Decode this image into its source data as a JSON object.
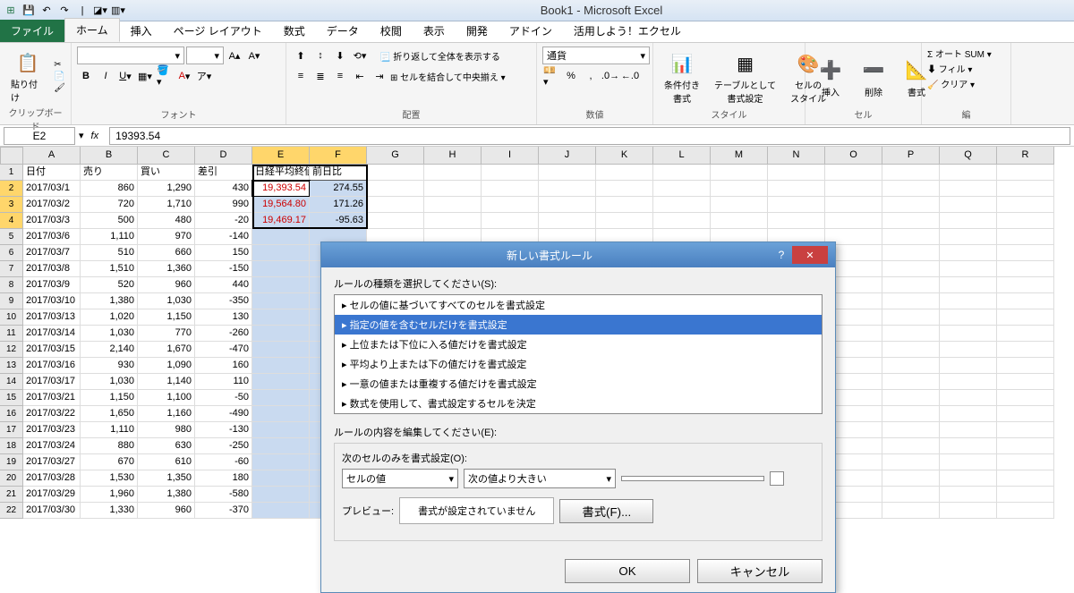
{
  "app": {
    "title": "Book1 - Microsoft Excel"
  },
  "tabs": {
    "file": "ファイル",
    "home": "ホーム",
    "insert": "挿入",
    "layout": "ページ レイアウト",
    "formula": "数式",
    "data": "データ",
    "review": "校閲",
    "view": "表示",
    "dev": "開発",
    "addin": "アドイン",
    "use": "活用しよう！エクセル"
  },
  "ribbon": {
    "clipboard": {
      "paste": "貼り付け",
      "label": "クリップボード"
    },
    "font": {
      "name": "",
      "size": "",
      "label": "フォント"
    },
    "align": {
      "wrap": "折り返して全体を表示する",
      "merge": "セルを結合して中央揃え",
      "label": "配置"
    },
    "number": {
      "format": "通貨",
      "label": "数値"
    },
    "styles": {
      "cond": "条件付き\n書式",
      "tbl": "テーブルとして\n書式設定",
      "cellst": "セルの\nスタイル",
      "label": "スタイル"
    },
    "cells": {
      "ins": "挿入",
      "del": "削除",
      "fmt": "書式",
      "label": "セル"
    },
    "editing": {
      "sum": "オート SUM",
      "fill": "フィル",
      "clear": "クリア",
      "label": "編"
    }
  },
  "formula_bar": {
    "name": "E2",
    "value": "19393.54"
  },
  "columns": [
    "A",
    "B",
    "C",
    "D",
    "E",
    "F",
    "G",
    "H",
    "I",
    "J",
    "K",
    "L",
    "M",
    "N",
    "O",
    "P",
    "Q",
    "R"
  ],
  "headers": [
    "日付",
    "売り",
    "買い",
    "差引",
    "日経平均終値",
    "前日比"
  ],
  "rows": [
    {
      "d": "2017/03/1",
      "s": "860",
      "b": "1,290",
      "df": "430",
      "n": "19,393.54",
      "p": "274.55"
    },
    {
      "d": "2017/03/2",
      "s": "720",
      "b": "1,710",
      "df": "990",
      "n": "19,564.80",
      "p": "171.26"
    },
    {
      "d": "2017/03/3",
      "s": "500",
      "b": "480",
      "df": "-20",
      "n": "19,469.17",
      "p": "-95.63"
    },
    {
      "d": "2017/03/6",
      "s": "1,110",
      "b": "970",
      "df": "-140",
      "n": "",
      "p": ""
    },
    {
      "d": "2017/03/7",
      "s": "510",
      "b": "660",
      "df": "150",
      "n": "",
      "p": ""
    },
    {
      "d": "2017/03/8",
      "s": "1,510",
      "b": "1,360",
      "df": "-150",
      "n": "",
      "p": ""
    },
    {
      "d": "2017/03/9",
      "s": "520",
      "b": "960",
      "df": "440",
      "n": "",
      "p": ""
    },
    {
      "d": "2017/03/10",
      "s": "1,380",
      "b": "1,030",
      "df": "-350",
      "n": "",
      "p": ""
    },
    {
      "d": "2017/03/13",
      "s": "1,020",
      "b": "1,150",
      "df": "130",
      "n": "",
      "p": ""
    },
    {
      "d": "2017/03/14",
      "s": "1,030",
      "b": "770",
      "df": "-260",
      "n": "",
      "p": ""
    },
    {
      "d": "2017/03/15",
      "s": "2,140",
      "b": "1,670",
      "df": "-470",
      "n": "",
      "p": ""
    },
    {
      "d": "2017/03/16",
      "s": "930",
      "b": "1,090",
      "df": "160",
      "n": "",
      "p": ""
    },
    {
      "d": "2017/03/17",
      "s": "1,030",
      "b": "1,140",
      "df": "110",
      "n": "",
      "p": ""
    },
    {
      "d": "2017/03/21",
      "s": "1,150",
      "b": "1,100",
      "df": "-50",
      "n": "",
      "p": ""
    },
    {
      "d": "2017/03/22",
      "s": "1,650",
      "b": "1,160",
      "df": "-490",
      "n": "",
      "p": ""
    },
    {
      "d": "2017/03/23",
      "s": "1,110",
      "b": "980",
      "df": "-130",
      "n": "",
      "p": ""
    },
    {
      "d": "2017/03/24",
      "s": "880",
      "b": "630",
      "df": "-250",
      "n": "",
      "p": ""
    },
    {
      "d": "2017/03/27",
      "s": "670",
      "b": "610",
      "df": "-60",
      "n": "",
      "p": ""
    },
    {
      "d": "2017/03/28",
      "s": "1,530",
      "b": "1,350",
      "df": "180",
      "n": "",
      "p": ""
    },
    {
      "d": "2017/03/29",
      "s": "1,960",
      "b": "1,380",
      "df": "-580",
      "n": "",
      "p": ""
    },
    {
      "d": "2017/03/30",
      "s": "1,330",
      "b": "960",
      "df": "-370",
      "n": "",
      "p": ""
    }
  ],
  "dialog": {
    "title": "新しい書式ルール",
    "rule_type_label": "ルールの種類を選択してください(S):",
    "rules": [
      "セルの値に基づいてすべてのセルを書式設定",
      "指定の値を含むセルだけを書式設定",
      "上位または下位に入る値だけを書式設定",
      "平均より上または下の値だけを書式設定",
      "一意の値または重複する値だけを書式設定",
      "数式を使用して、書式設定するセルを決定"
    ],
    "edit_label": "ルールの内容を編集してください(E):",
    "only_label": "次のセルのみを書式設定(O):",
    "sel1": "セルの値",
    "sel2": "次の値より大きい",
    "preview_label": "プレビュー:",
    "preview_text": "書式が設定されていません",
    "format_btn": "書式(F)...",
    "ok": "OK",
    "cancel": "キャンセル"
  }
}
